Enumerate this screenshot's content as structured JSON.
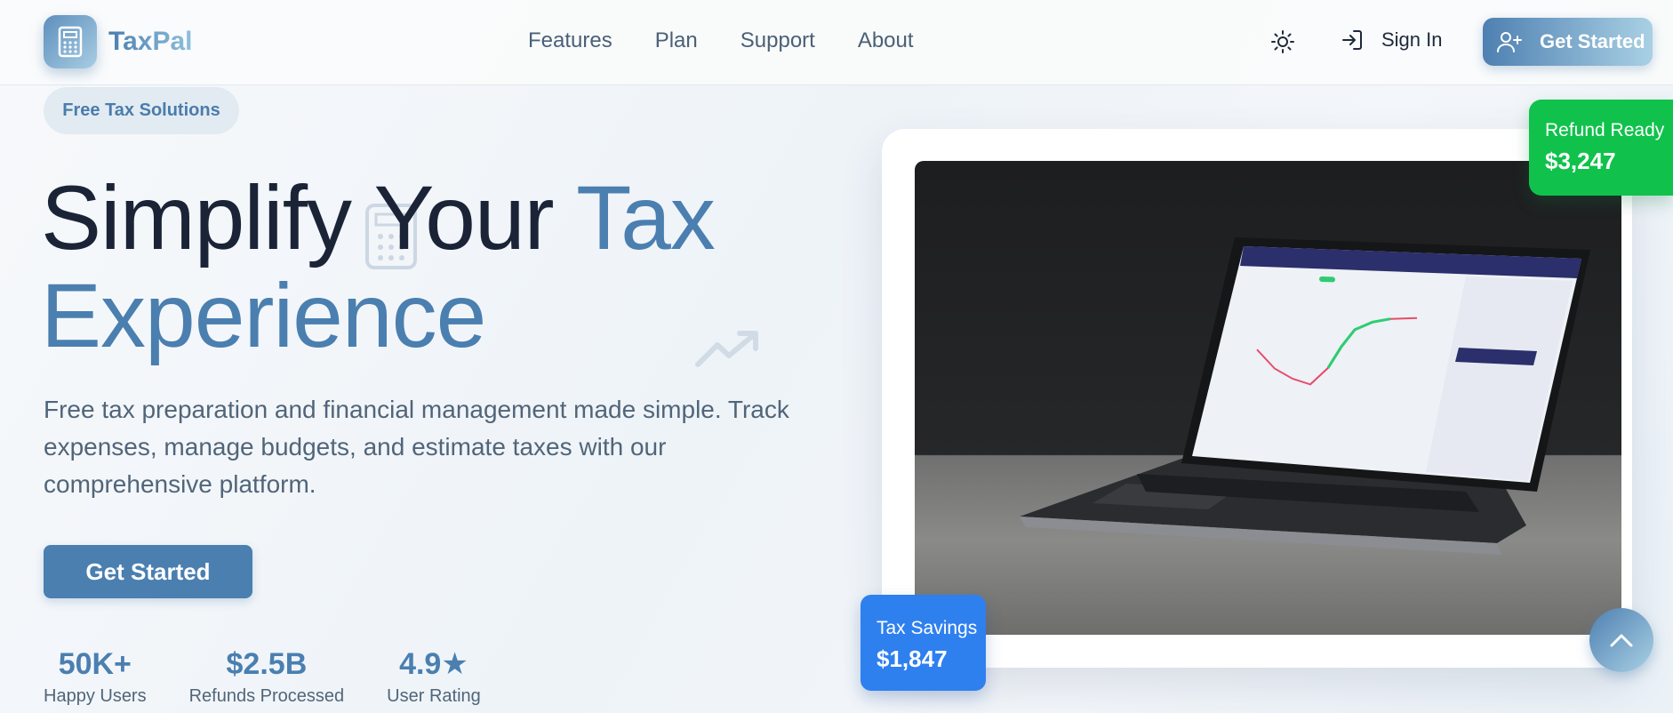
{
  "brand": {
    "name": "TaxPal",
    "logo_icon": "calculator-icon"
  },
  "nav": {
    "links": [
      "Features",
      "Plan",
      "Support",
      "About"
    ],
    "theme_icon": "sun-icon",
    "signin_icon": "login-arrow-icon",
    "signin_label": "Sign In",
    "get_started_icon": "user-plus-icon",
    "get_started_label": "Get Started"
  },
  "hero": {
    "pill": "Free Tax Solutions",
    "headline_line1_dark": "Simplify Your ",
    "headline_line1_blue": "Tax",
    "headline_line2": "Experience",
    "subtitle": "Free tax preparation and financial management made simple. Track expenses, manage budgets, and estimate taxes with our comprehensive platform.",
    "cta": "Get Started",
    "stats": [
      {
        "value": "50K+",
        "label": "Happy Users"
      },
      {
        "value": "$2.5B",
        "label": "Refunds Processed"
      },
      {
        "value": "4.9★",
        "label": "User Rating"
      }
    ]
  },
  "showcase": {
    "refund_badge": {
      "title": "Refund Ready",
      "amount": "$3,247"
    },
    "savings_badge": {
      "title": "Tax Savings",
      "amount": "$1,847"
    },
    "scroll_icon": "chevron-up-icon"
  },
  "colors": {
    "accent": "#4a7fb0",
    "refund_green": "#10c24b",
    "savings_blue": "#2f80ef"
  }
}
